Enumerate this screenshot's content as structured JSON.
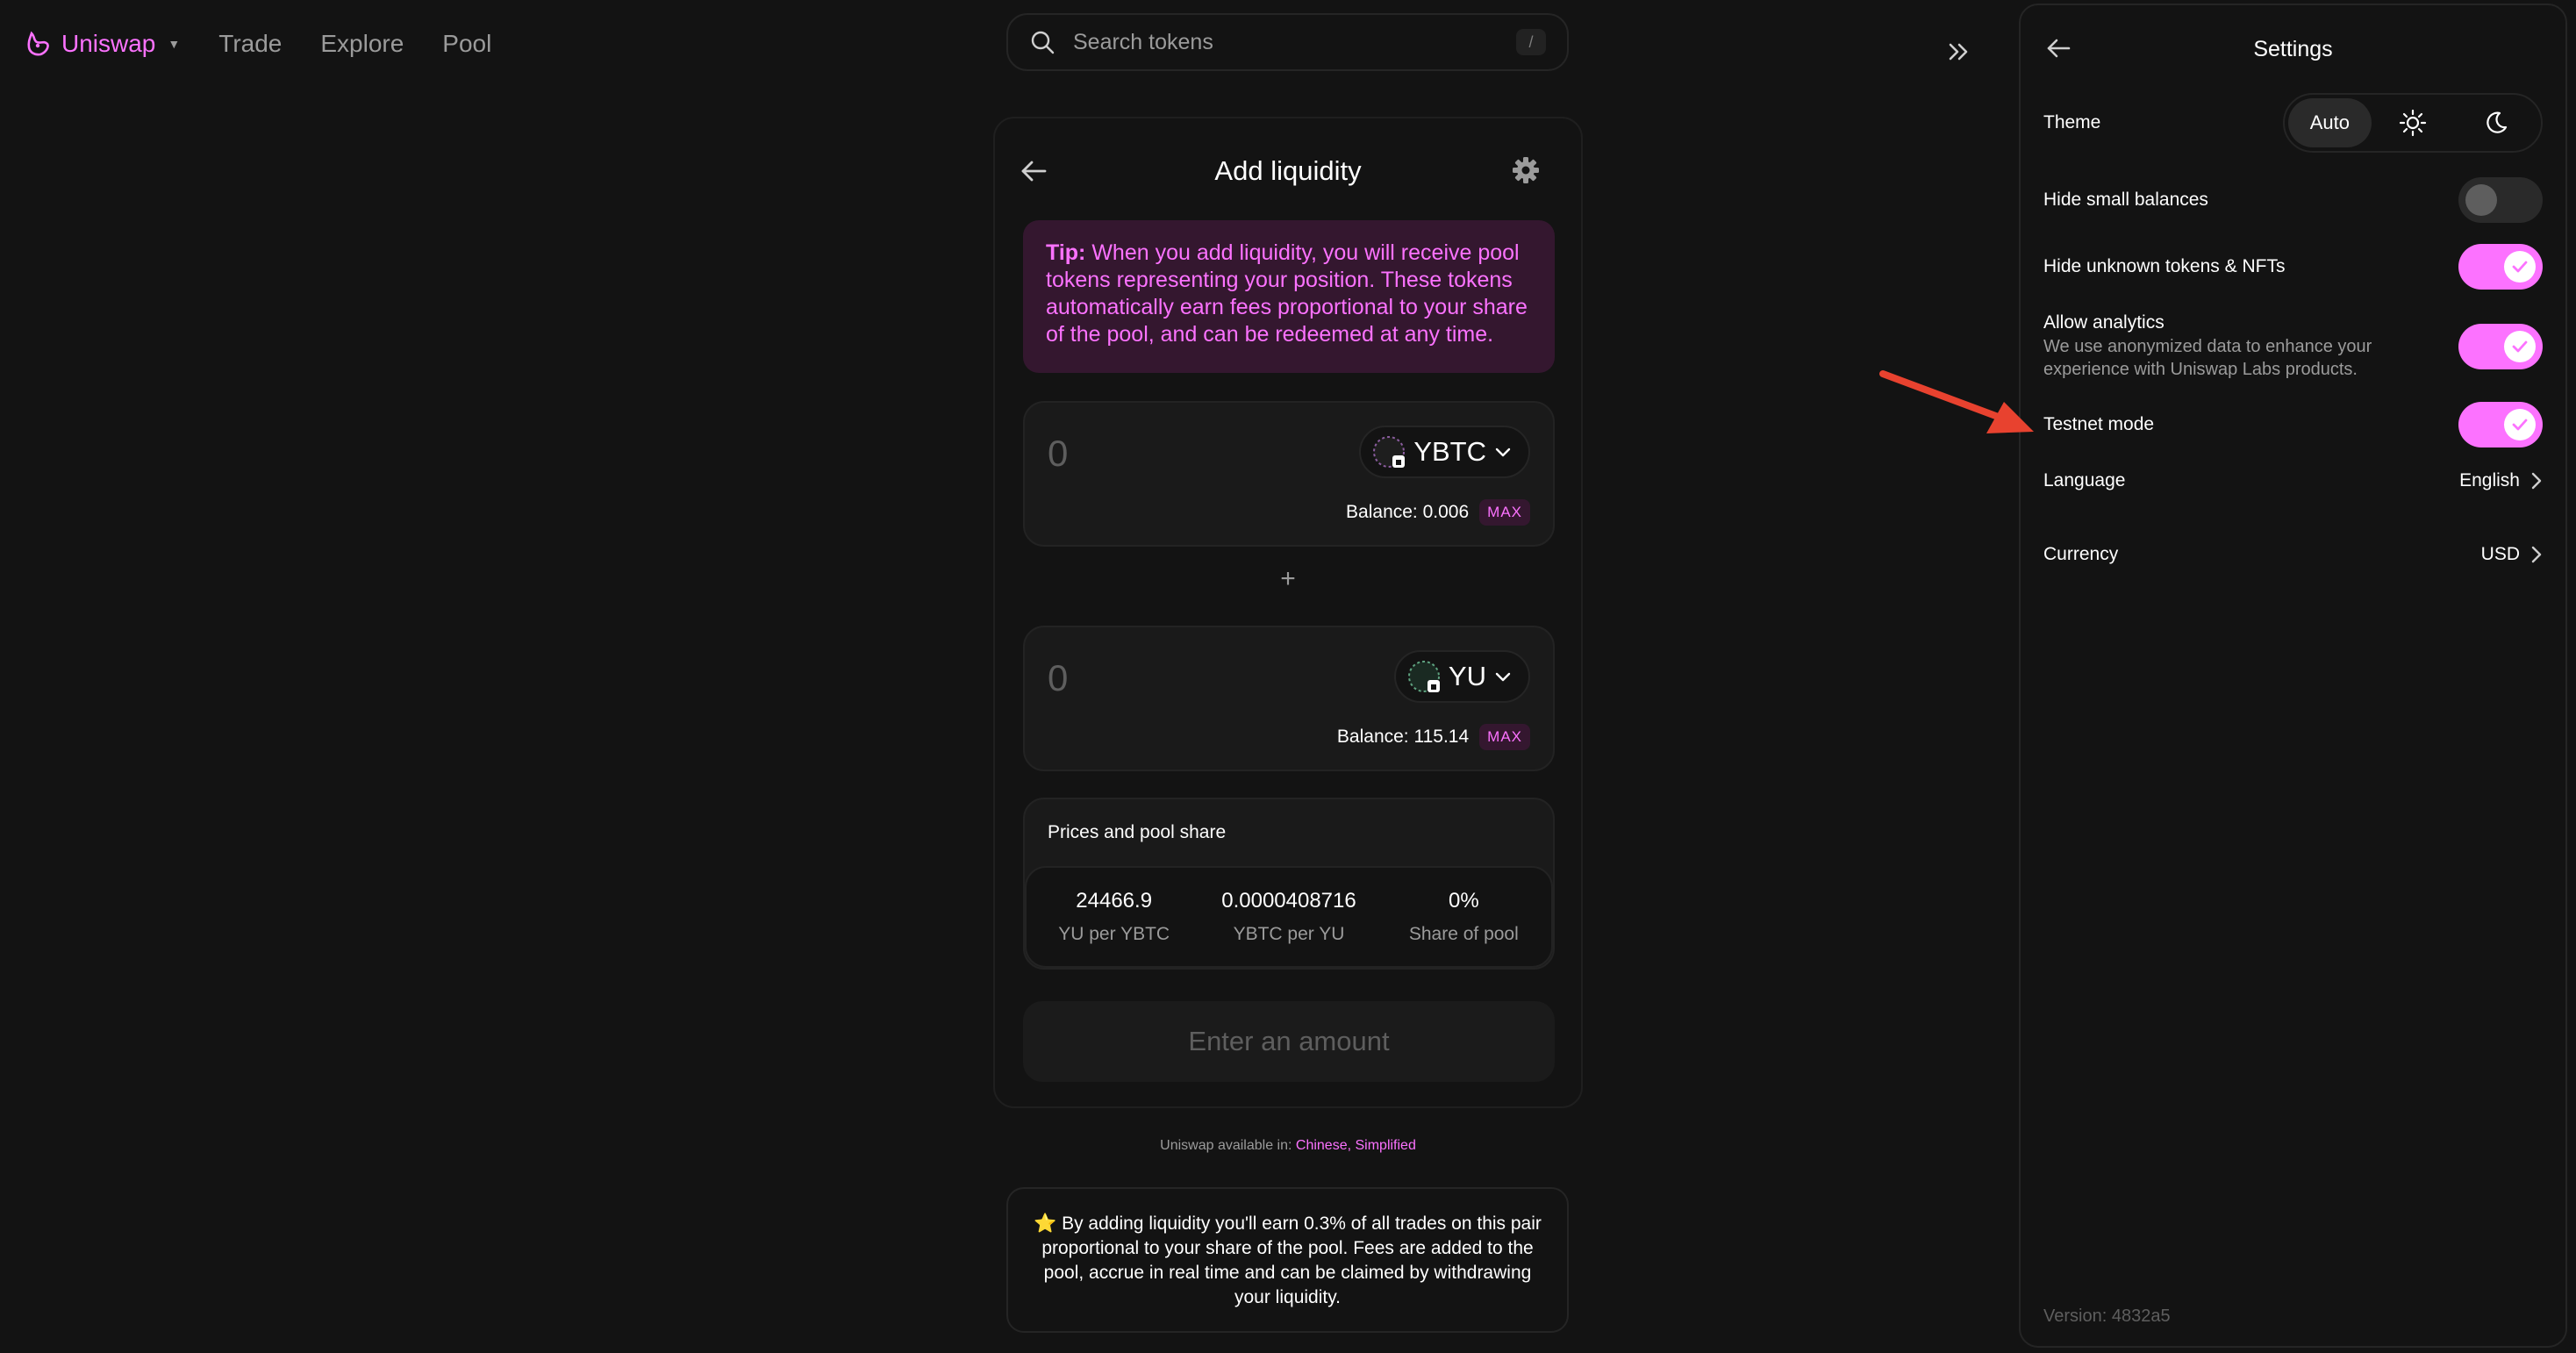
{
  "nav": {
    "brand": "Uniswap",
    "links": [
      "Trade",
      "Explore",
      "Pool"
    ],
    "search_placeholder": "Search tokens",
    "search_shortcut": "/"
  },
  "add_liquidity": {
    "title": "Add liquidity",
    "tip_label": "Tip:",
    "tip_text": " When you add liquidity, you will receive pool tokens representing your position. These tokens automatically earn fees proportional to your share of the pool, and can be redeemed at any time.",
    "token_a": {
      "amount": "0",
      "symbol": "YBTC",
      "balance": "Balance: 0.006",
      "max": "MAX"
    },
    "plus": "+",
    "token_b": {
      "amount": "0",
      "symbol": "YU",
      "balance": "Balance: 115.14",
      "max": "MAX"
    },
    "prices": {
      "title": "Prices and pool share",
      "items": [
        {
          "value": "24466.9",
          "label": "YU per YBTC"
        },
        {
          "value": "0.0000408716",
          "label": "YBTC per YU"
        },
        {
          "value": "0%",
          "label": "Share of pool"
        }
      ]
    },
    "button": "Enter an amount"
  },
  "availability": {
    "prefix": "Uniswap available in: ",
    "language": "Chinese, Simplified"
  },
  "info": "⭐️ By adding liquidity you'll earn 0.3% of all trades on this pair proportional to your share of the pool. Fees are added to the pool, accrue in real time and can be claimed by withdrawing your liquidity.",
  "settings": {
    "title": "Settings",
    "theme_label": "Theme",
    "theme_auto": "Auto",
    "hide_small": {
      "label": "Hide small balances",
      "on": false
    },
    "hide_unknown": {
      "label": "Hide unknown tokens & NFTs",
      "on": true
    },
    "analytics": {
      "label": "Allow analytics",
      "sub": "We use anonymized data to enhance your experience with Uniswap Labs products.",
      "on": true
    },
    "testnet": {
      "label": "Testnet mode",
      "on": true
    },
    "language": {
      "label": "Language",
      "value": "English"
    },
    "currency": {
      "label": "Currency",
      "value": "USD"
    },
    "version": "Version: 4832a5"
  },
  "colors": {
    "accent": "#fc72ff",
    "annotation_arrow": "#e8422f",
    "background": "#131313"
  }
}
